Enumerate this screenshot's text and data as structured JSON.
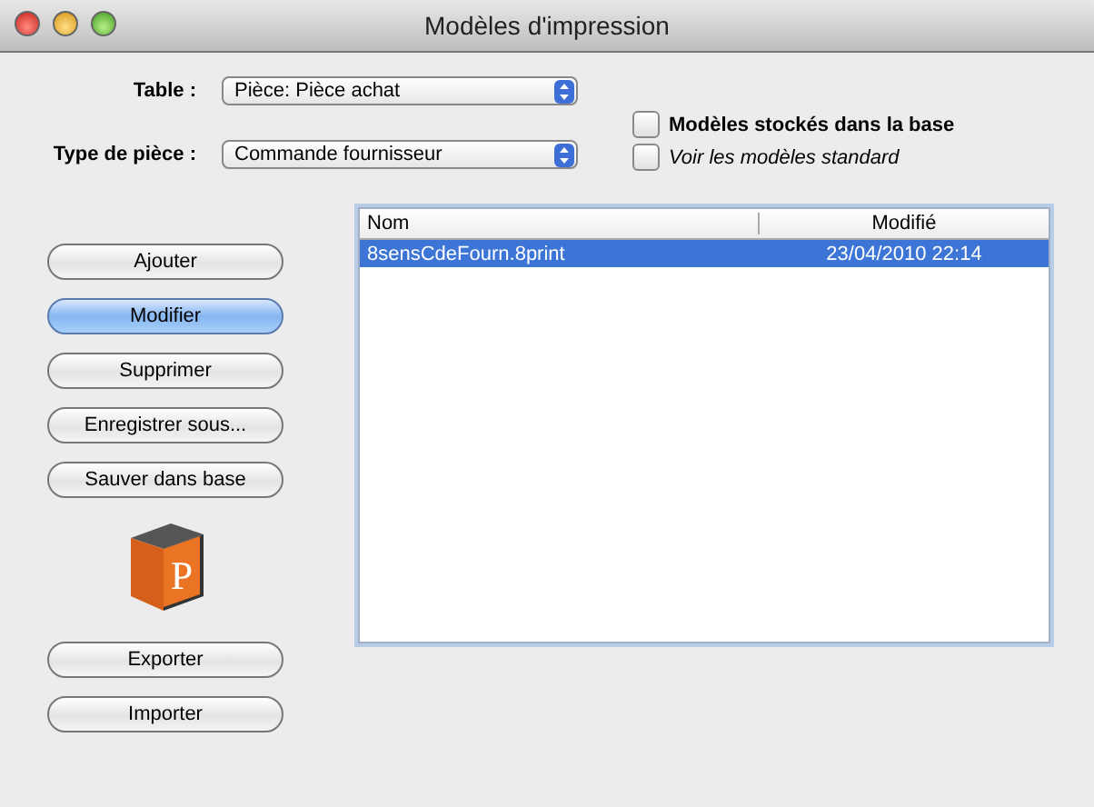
{
  "window": {
    "title": "Modèles d'impression"
  },
  "fields": [
    {
      "label": "Table :",
      "value": "Pièce: Pièce achat"
    },
    {
      "label": "Type de pièce :",
      "value": "Commande fournisseur"
    }
  ],
  "checkboxes": [
    {
      "label": "Modèles stockés dans la base",
      "checked": false
    },
    {
      "label": "Voir les modèles standard",
      "checked": false
    }
  ],
  "buttons": [
    {
      "label": "Ajouter",
      "default": false
    },
    {
      "label": "Modifier",
      "default": true
    },
    {
      "label": "Supprimer",
      "default": false
    },
    {
      "label": "Enregistrer sous...",
      "default": false
    },
    {
      "label": "Sauver dans base",
      "default": false
    }
  ],
  "logo": {
    "letter": "P"
  },
  "buttons_bottom": [
    {
      "label": "Exporter",
      "default": false
    },
    {
      "label": "Importer",
      "default": false
    }
  ],
  "table": {
    "columns": [
      "Nom",
      "Modifié"
    ],
    "rows": [
      {
        "cells": [
          "8sensCdeFourn.8print",
          "23/04/2010 22:14"
        ],
        "selected": true
      }
    ]
  }
}
